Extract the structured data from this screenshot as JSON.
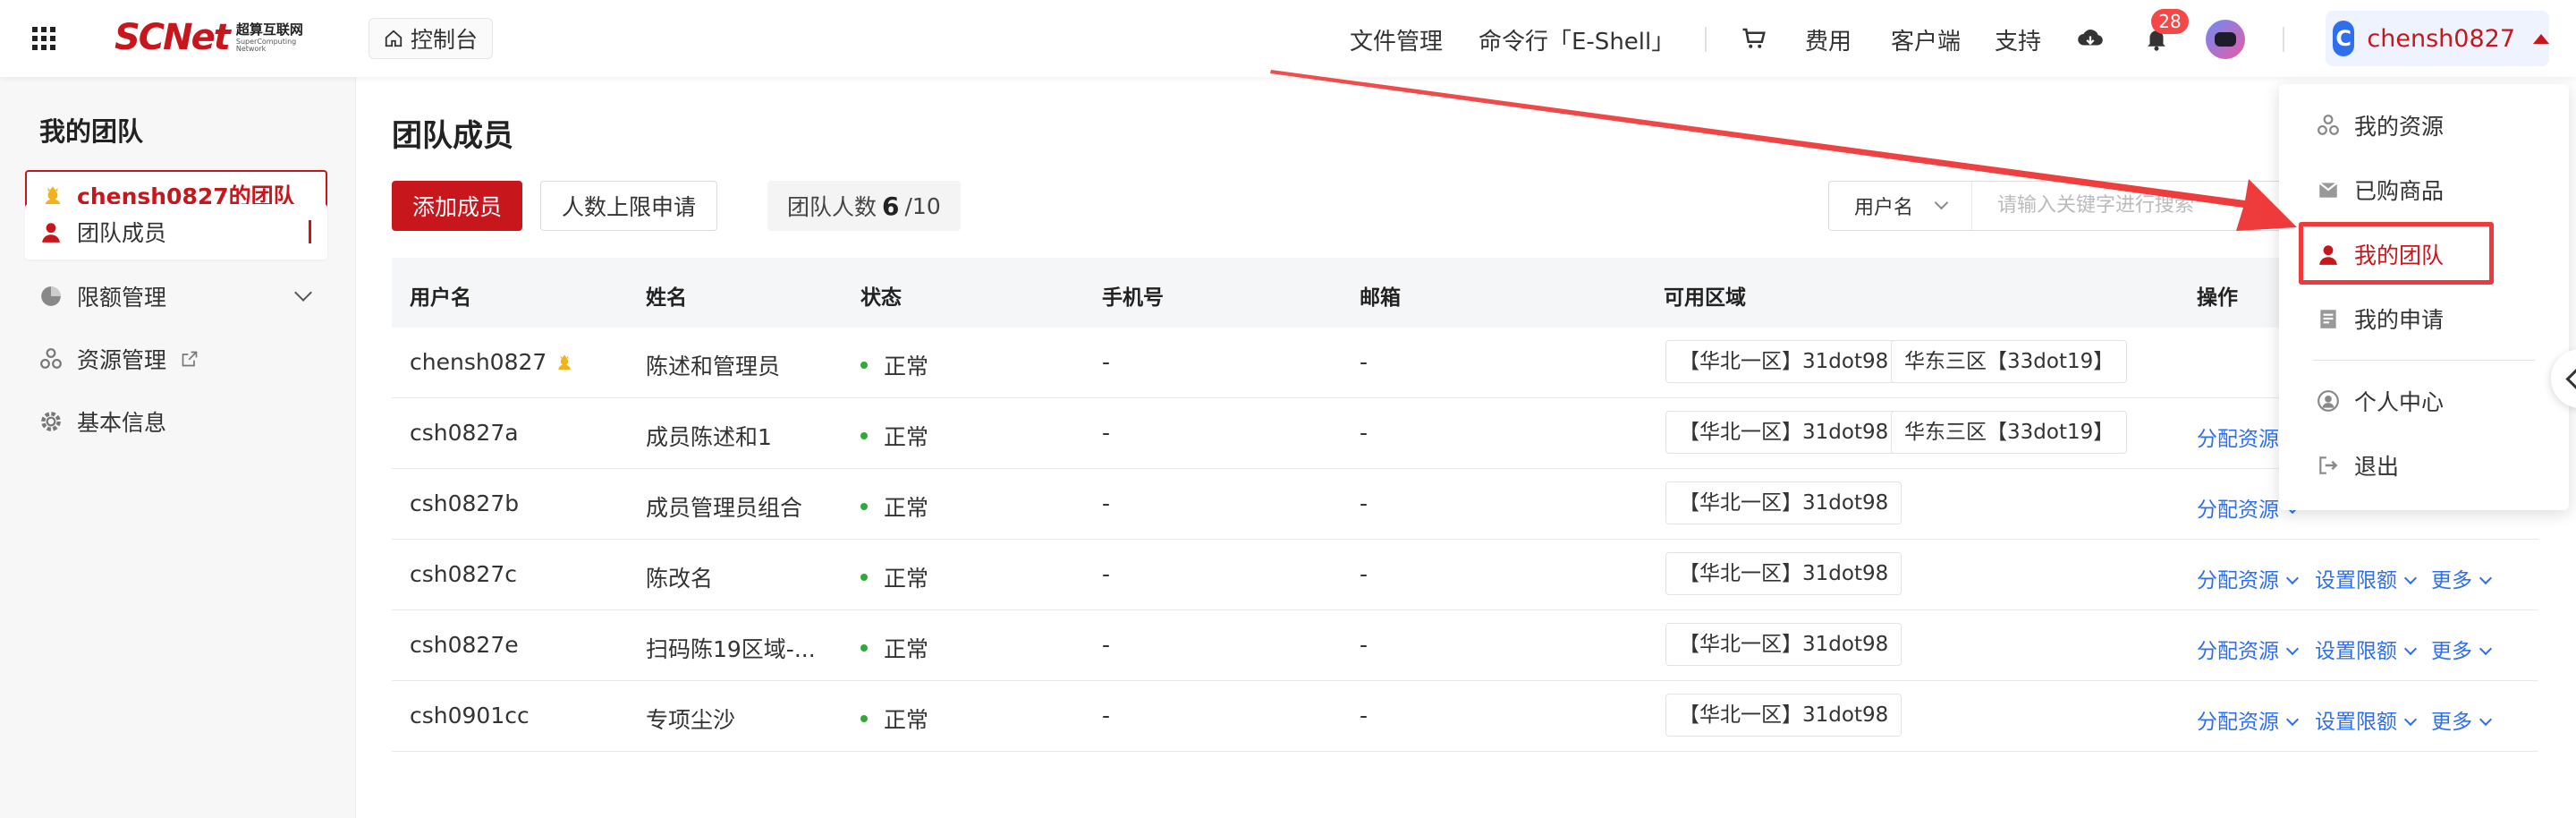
{
  "header": {
    "logo_text": "SCNet",
    "logo_cn": "超算互联网",
    "logo_en": "SuperComputing Network",
    "console_label": "控制台",
    "nav": {
      "file_mgmt": "文件管理",
      "shell": "命令行「E-Shell」",
      "fees": "费用",
      "client": "客户端",
      "support": "支持"
    },
    "notification_count": "28",
    "user_initial": "C",
    "user_name": "chensh0827"
  },
  "sidebar": {
    "title": "我的团队",
    "team_name": "chensh0827的团队",
    "items": [
      {
        "label": "团队成员"
      },
      {
        "label": "限额管理"
      },
      {
        "label": "资源管理"
      },
      {
        "label": "基本信息"
      }
    ]
  },
  "main": {
    "title": "团队成员",
    "add_member": "添加成员",
    "limit_apply": "人数上限申请",
    "team_count_label": "团队人数",
    "team_count_current": "6",
    "team_count_max": "/10",
    "search_field": "用户名",
    "search_placeholder": "请输入关键字进行搜索",
    "columns": [
      "用户名",
      "姓名",
      "状态",
      "手机号",
      "邮箱",
      "可用区域",
      "操作"
    ],
    "rows": [
      {
        "username": "chensh0827",
        "name": "陈述和管理员",
        "status": "正常",
        "phone": "-",
        "email": "-",
        "regions": [
          "【华北一区】31dot98",
          "华东三区【33dot19】"
        ],
        "actions": []
      },
      {
        "username": "csh0827a",
        "name": "成员陈述和1",
        "status": "正常",
        "phone": "-",
        "email": "-",
        "regions": [
          "【华北一区】31dot98",
          "华东三区【33dot19】"
        ],
        "actions": [
          "分配资源"
        ]
      },
      {
        "username": "csh0827b",
        "name": "成员管理员组合",
        "status": "正常",
        "phone": "-",
        "email": "-",
        "regions": [
          "【华北一区】31dot98"
        ],
        "actions": [
          "分配资源"
        ]
      },
      {
        "username": "csh0827c",
        "name": "陈改名",
        "status": "正常",
        "phone": "-",
        "email": "-",
        "regions": [
          "【华北一区】31dot98"
        ],
        "actions": [
          "分配资源",
          "设置限额",
          "更多"
        ]
      },
      {
        "username": "csh0827e",
        "name": "扫码陈19区域-...",
        "status": "正常",
        "phone": "-",
        "email": "-",
        "regions": [
          "【华北一区】31dot98"
        ],
        "actions": [
          "分配资源",
          "设置限额",
          "更多"
        ]
      },
      {
        "username": "csh0901cc",
        "name": "专项尘沙",
        "status": "正常",
        "phone": "-",
        "email": "-",
        "regions": [
          "【华北一区】31dot98"
        ],
        "actions": [
          "分配资源",
          "设置限额",
          "更多"
        ]
      }
    ]
  },
  "user_menu": {
    "items": [
      {
        "label": "我的资源"
      },
      {
        "label": "已购商品"
      },
      {
        "label": "我的团队"
      },
      {
        "label": "我的申请"
      },
      {
        "label": "个人中心"
      },
      {
        "label": "退出"
      }
    ]
  },
  "colors": {
    "brand_red": "#c8161d",
    "link_blue": "#2f6fed",
    "status_green": "#2eaa3c",
    "annotation_red": "#ee3a3a"
  }
}
